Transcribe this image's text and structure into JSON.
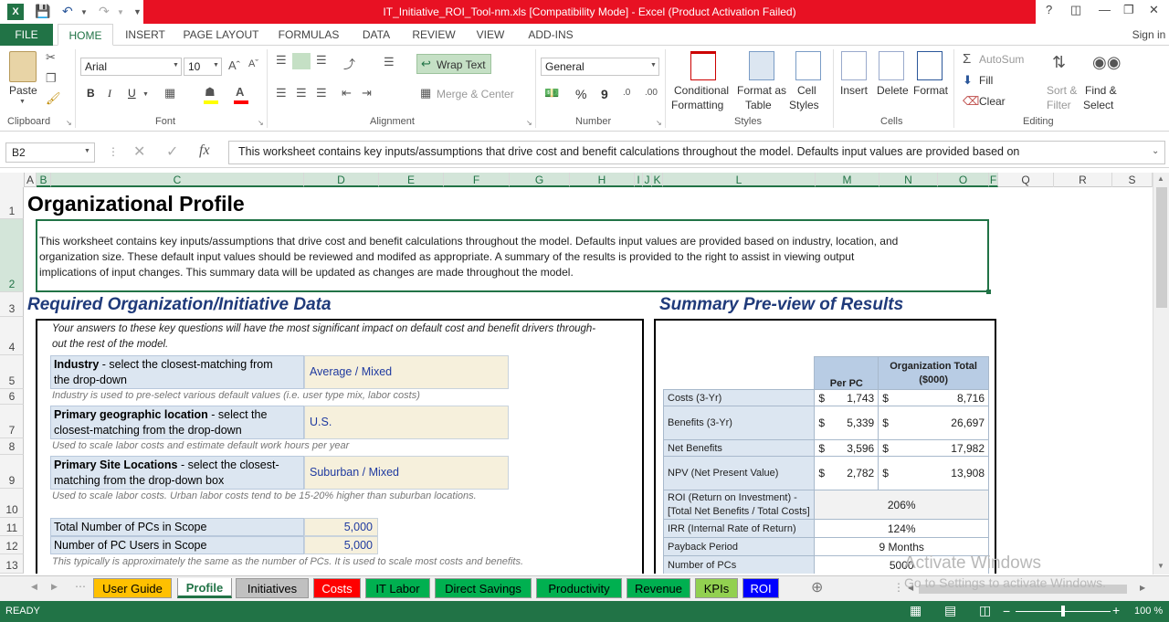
{
  "window": {
    "title": "IT_Initiative_ROI_Tool-nm.xls  [Compatibility Mode] -  Excel (Product Activation Failed)",
    "signin": "Sign in"
  },
  "ribbon_tabs": [
    "FILE",
    "HOME",
    "INSERT",
    "PAGE LAYOUT",
    "FORMULAS",
    "DATA",
    "REVIEW",
    "VIEW",
    "ADD-INS"
  ],
  "ribbon": {
    "clipboard": {
      "paste": "Paste",
      "label": "Clipboard"
    },
    "font": {
      "name": "Arial",
      "size": "10",
      "bold": "B",
      "italic": "I",
      "underline": "U",
      "label": "Font"
    },
    "alignment": {
      "wrap": "Wrap Text",
      "merge": "Merge & Center",
      "label": "Alignment"
    },
    "number": {
      "format": "General",
      "percent": "%",
      "comma": "9",
      "label": "Number"
    },
    "styles": {
      "conditional": "Conditional",
      "conditional2": "Formatting",
      "format_table": "Format as",
      "format_table2": "Table",
      "cell_styles": "Cell",
      "cell_styles2": "Styles",
      "label": "Styles"
    },
    "cells": {
      "insert": "Insert",
      "delete": "Delete",
      "format": "Format",
      "label": "Cells"
    },
    "editing": {
      "autosum": "AutoSum",
      "fill": "Fill",
      "clear": "Clear",
      "sort": "Sort &",
      "sort2": "Filter",
      "find": "Find &",
      "find2": "Select",
      "label": "Editing"
    }
  },
  "formula_bar": {
    "name_box": "B2",
    "fx": "fx",
    "content": "This worksheet contains key inputs/assumptions that drive cost and benefit calculations throughout the model.  Defaults input values are provided based on"
  },
  "columns": [
    "A",
    "B",
    "C",
    "D",
    "E",
    "F",
    "G",
    "H",
    "I",
    "J",
    "K",
    "L",
    "M",
    "N",
    "O",
    "F",
    "Q",
    "R",
    "S"
  ],
  "rows": [
    "1",
    "2",
    "3",
    "4",
    "5",
    "6",
    "7",
    "8",
    "9",
    "10",
    "11",
    "12",
    "13"
  ],
  "sheet": {
    "title": "Organizational Profile",
    "intro": [
      "This worksheet contains key inputs/assumptions that drive cost and benefit calculations throughout the model.  Defaults input values are provided based on industry, location, and",
      "organization size.  These default input values should be reviewed and modifed as appropriate.  A summary of the results is provided to the right to assist in viewing output",
      "implications of input changes.  This summary data will be updated as changes are made throughout the model."
    ],
    "required_heading": "Required Organization/Initiative Data",
    "summary_heading": "Summary Pre-view of Results",
    "key_q_note": [
      "Your answers to these key questions will have the most significant impact on default cost and benefit drivers through-",
      "out the rest of the model."
    ],
    "questions": [
      {
        "bold": "Industry",
        "rest": " - select the closest-matching from",
        "line2": "the drop-down",
        "value": "Average / Mixed",
        "note": "Industry is used to pre-select various default values (i.e. user type mix, labor costs)"
      },
      {
        "bold": "Primary geographic location",
        "rest": " - select the",
        "line2": "closest-matching from the drop-down",
        "value": "U.S.",
        "note": "Used to scale labor costs and estimate default work hours per year"
      },
      {
        "bold": "Primary Site Locations",
        "rest": " - select the closest-",
        "line2": "matching from the drop-down box",
        "value": "Suburban / Mixed",
        "note": "Used to scale labor costs.  Urban labor costs tend to be 15-20% higher than suburban locations."
      }
    ],
    "counts": [
      {
        "label": "Total Number of PCs in Scope",
        "value": "5,000"
      },
      {
        "label": "Number of PC Users in Scope",
        "value": "5,000"
      }
    ],
    "counts_note": "This typically is approximately the same as the number of PCs.  It is used to scale most costs and benefits."
  },
  "summary": {
    "headers": {
      "per_pc": "Per PC",
      "org_total": "Organization Total",
      "org_total2": "($000)"
    },
    "rows": [
      {
        "label": "Costs (3-Yr)",
        "cur1": "$",
        "per_pc": "1,743",
        "cur2": "$",
        "total": "8,716"
      },
      {
        "label": "Benefits (3-Yr)",
        "cur1": "$",
        "per_pc": "5,339",
        "cur2": "$",
        "total": "26,697"
      },
      {
        "label": "Net Benefits",
        "cur1": "$",
        "per_pc": "3,596",
        "cur2": "$",
        "total": "17,982"
      },
      {
        "label": "NPV (Net Present Value)",
        "cur1": "$",
        "per_pc": "2,782",
        "cur2": "$",
        "total": "13,908"
      }
    ],
    "roi_label": "ROI (Return on Investment) -",
    "roi_label2": "[Total Net Benefits / Total Costs]",
    "roi": "206%",
    "irr_label": "IRR (Internal Rate of Return)",
    "irr": "124%",
    "payback_label": "Payback Period",
    "payback": "9 Months",
    "pcs_label": "Number of PCs",
    "pcs": "5000"
  },
  "sheet_tabs": [
    {
      "label": "User Guide",
      "color": "#ffc000"
    },
    {
      "label": "Profile",
      "color": "#ffffff"
    },
    {
      "label": "Initiatives",
      "color": "#c0c0c0"
    },
    {
      "label": "Costs",
      "color": "#ff0000"
    },
    {
      "label": "IT Labor",
      "color": "#00b050"
    },
    {
      "label": "Direct Savings",
      "color": "#00b050"
    },
    {
      "label": "Productivity",
      "color": "#00b050"
    },
    {
      "label": "Revenue",
      "color": "#00b050"
    },
    {
      "label": "KPIs",
      "color": "#92d050"
    },
    {
      "label": "ROI",
      "color": "#0000ff"
    }
  ],
  "status": {
    "ready": "READY",
    "zoom": "100 %"
  },
  "watermark": {
    "line1": "Activate Windows",
    "line2": "Go to Settings to activate Windows."
  },
  "colors": {
    "excel_green": "#217346",
    "title_red": "#e81123",
    "heading_blue": "#1f3a7a",
    "label_blue": "#dce6f1",
    "input_beige": "#f6f0dc"
  }
}
